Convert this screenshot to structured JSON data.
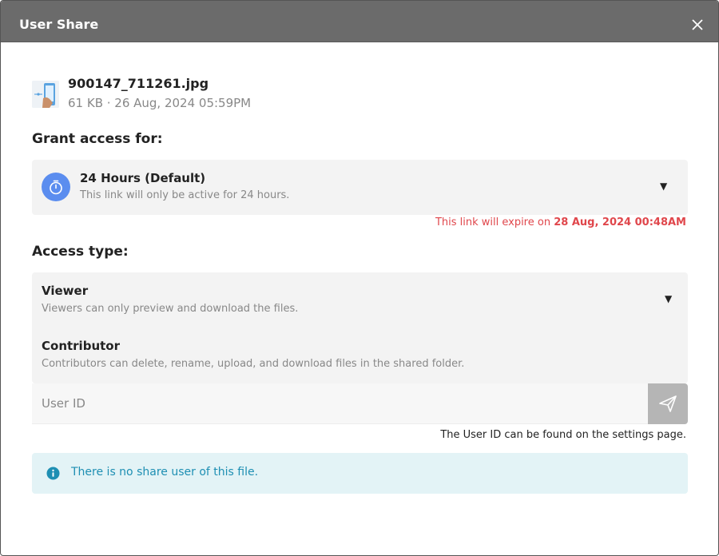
{
  "dialog": {
    "title": "User Share",
    "close_icon": "close-icon"
  },
  "file": {
    "name": "900147_711261.jpg",
    "meta": "61 KB · 26 Aug, 2024 05:59PM",
    "thumbnail_icon": "image-thumbnail"
  },
  "grant_access": {
    "label": "Grant access for:",
    "selected_title": "24 Hours (Default)",
    "selected_desc": "This link will only be active for 24 hours.",
    "icon": "timer-icon",
    "accent_color": "#5b8def",
    "expire_prefix": "This link will expire on ",
    "expire_date": "28 Aug, 2024 00:48AM",
    "expire_color": "#e0474c"
  },
  "access_type": {
    "label": "Access type:",
    "options": [
      {
        "title": "Viewer",
        "desc": "Viewers can only preview and download the files."
      },
      {
        "title": "Contributor",
        "desc": "Contributors can delete, rename, upload, and download files in the shared folder."
      }
    ]
  },
  "user_id": {
    "placeholder": "User ID",
    "value": "",
    "hint": "The User ID can be found on the settings page.",
    "send_icon": "send-icon"
  },
  "alert": {
    "text": "There is no share user of this file.",
    "icon": "info-icon",
    "color": "#1e8fb3"
  }
}
